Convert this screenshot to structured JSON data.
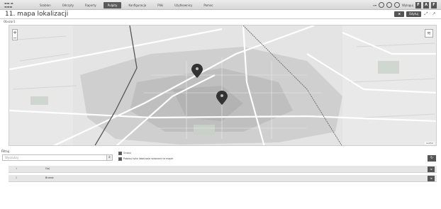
{
  "header": {
    "nav": [
      {
        "label": "Szablon",
        "active": false
      },
      {
        "label": "Odczyty",
        "active": false
      },
      {
        "label": "Raporty",
        "active": false
      },
      {
        "label": "Pulpity",
        "active": true
      },
      {
        "label": "Konfiguracja",
        "active": false
      },
      {
        "label": "Pliki",
        "active": false
      },
      {
        "label": "Użytkownicy",
        "active": false
      },
      {
        "label": "Pomoc",
        "active": false
      }
    ],
    "user_label": "Wyloguj"
  },
  "page": {
    "title": "11. mapa lokalizacji",
    "edit_button": "Edytuj",
    "layer_label": "Obszar1"
  },
  "map": {
    "attribution": "Leaflet",
    "zoom_in": "+",
    "zoom_out": "−"
  },
  "filter": {
    "label": "Filtruj",
    "placeholder": "Wyszukaj",
    "checkbox1": "Grupuj",
    "checkbox2": "Pokazuj tylko lokalizacje widoczne na mapie"
  },
  "list": {
    "items": [
      {
        "num": "1",
        "text": "Gaj"
      },
      {
        "num": "2",
        "text": "Brzesk"
      }
    ]
  }
}
